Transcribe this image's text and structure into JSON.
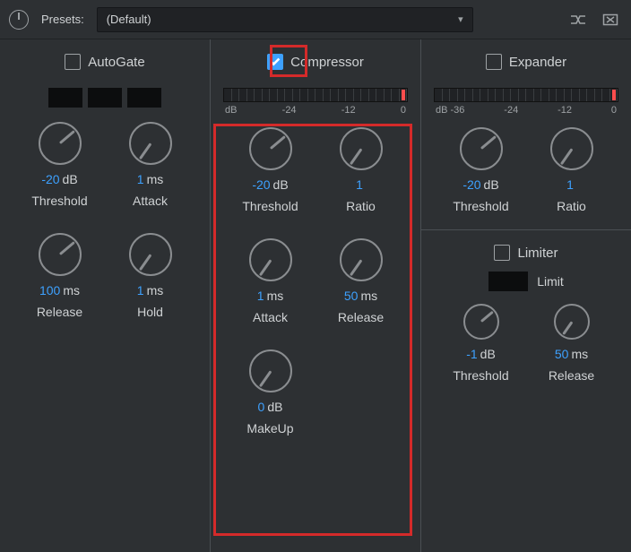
{
  "topbar": {
    "presets_label": "Presets:",
    "preset_value": "(Default)"
  },
  "autogate": {
    "title": "AutoGate",
    "checked": false,
    "threshold": {
      "value": "-20",
      "unit": "dB",
      "label": "Threshold"
    },
    "attack": {
      "value": "1",
      "unit": "ms",
      "label": "Attack"
    },
    "release": {
      "value": "100",
      "unit": "ms",
      "label": "Release"
    },
    "hold": {
      "value": "1",
      "unit": "ms",
      "label": "Hold"
    }
  },
  "compressor": {
    "title": "Compressor",
    "checked": true,
    "meter_scale": [
      "dB",
      "-24",
      "-12",
      "0"
    ],
    "threshold": {
      "value": "-20",
      "unit": "dB",
      "label": "Threshold"
    },
    "ratio": {
      "value": "1",
      "unit": "",
      "label": "Ratio"
    },
    "attack": {
      "value": "1",
      "unit": "ms",
      "label": "Attack"
    },
    "release": {
      "value": "50",
      "unit": "ms",
      "label": "Release"
    },
    "makeup": {
      "value": "0",
      "unit": "dB",
      "label": "MakeUp"
    }
  },
  "expander": {
    "title": "Expander",
    "checked": false,
    "meter_scale": [
      "dB -36",
      "-24",
      "-12",
      "0"
    ],
    "threshold": {
      "value": "-20",
      "unit": "dB",
      "label": "Threshold"
    },
    "ratio": {
      "value": "1",
      "unit": "",
      "label": "Ratio"
    }
  },
  "limiter": {
    "title": "Limiter",
    "checked": false,
    "limit_label": "Limit",
    "threshold": {
      "value": "-1",
      "unit": "dB",
      "label": "Threshold"
    },
    "release": {
      "value": "50",
      "unit": "ms",
      "label": "Release"
    }
  }
}
